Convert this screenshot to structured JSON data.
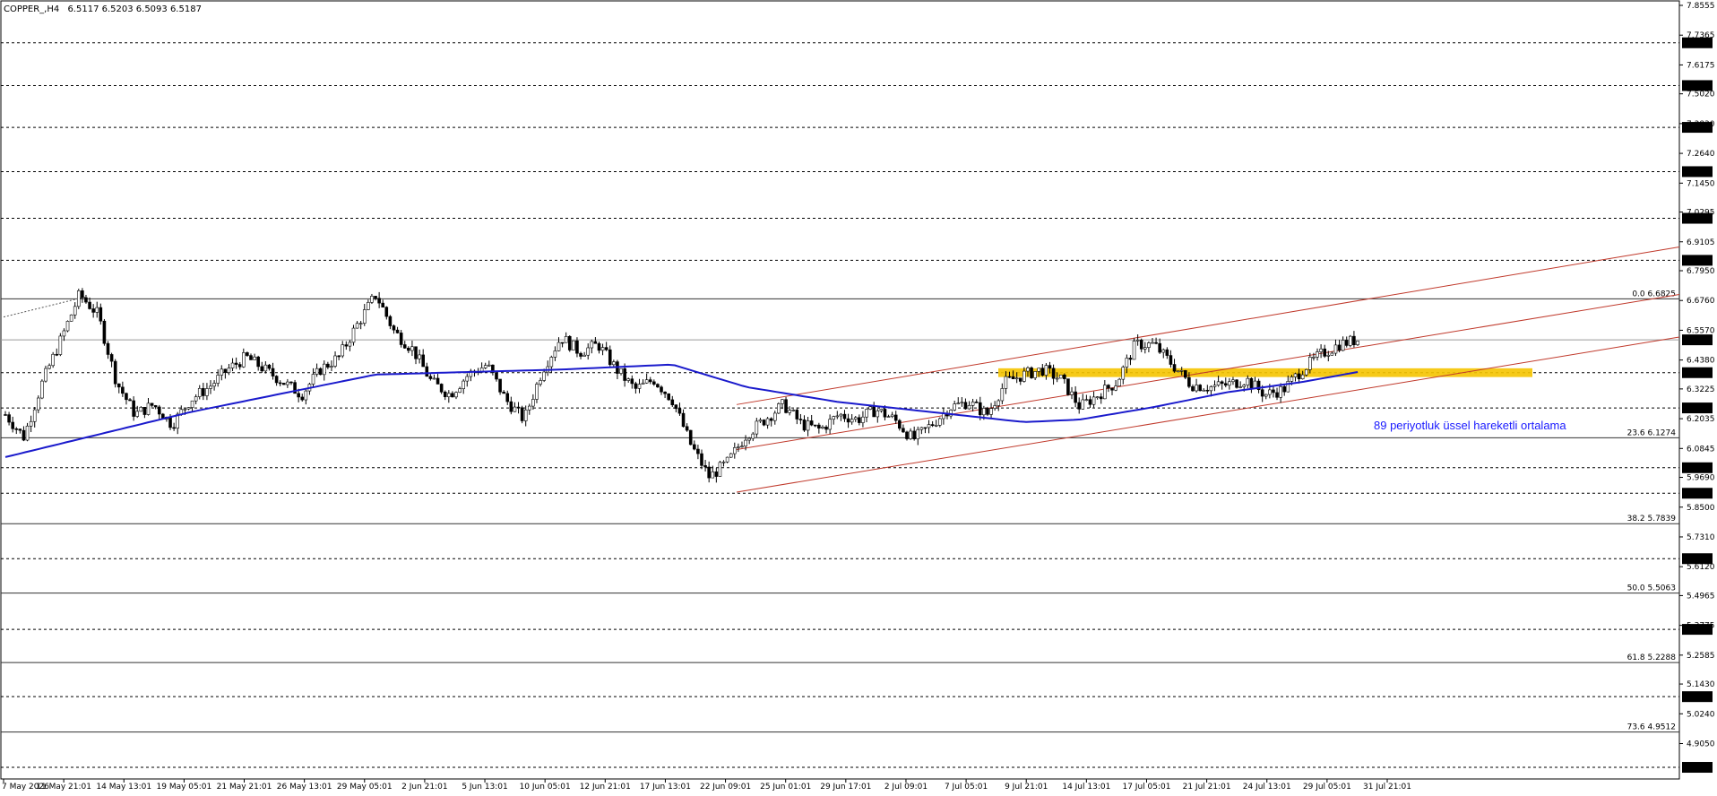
{
  "header": {
    "symbol": "COPPER_,H4",
    "ohlc": "6.5117 6.5203 6.5093 6.5187"
  },
  "annotation": "89 periyotluk üssel hareketli ortalama",
  "chart_data": {
    "type": "candlestick",
    "yaxis": {
      "range": [
        4.785,
        7.8555
      ],
      "ticks": [
        "7.8555",
        "7.7365",
        "7.6175",
        "7.5020",
        "7.3830",
        "7.2640",
        "7.1450",
        "7.0295",
        "6.9105",
        "6.7950",
        "6.6760",
        "6.5570",
        "6.4380",
        "6.3225",
        "6.2035",
        "6.0845",
        "5.9690",
        "5.8500",
        "5.7310",
        "5.6120",
        "5.4965",
        "5.3775",
        "5.2585",
        "5.1430",
        "5.0240",
        "4.9050"
      ]
    },
    "xaxis": {
      "ticks": [
        "7 May 2026",
        "11 May 21:01",
        "14 May 13:01",
        "19 May 05:01",
        "21 May 21:01",
        "26 May 13:01",
        "29 May 05:01",
        "2 Jun 21:01",
        "5 Jun 13:01",
        "10 Jun 05:01",
        "12 Jun 21:01",
        "17 Jun 13:01",
        "22 Jun 09:01",
        "25 Jun 01:01",
        "29 Jun 17:01",
        "2 Jul 09:01",
        "7 Jul 05:01",
        "9 Jul 21:01",
        "14 Jul 13:01",
        "17 Jul 05:01",
        "21 Jul 21:01",
        "24 Jul 13:01",
        "29 Jul 05:01",
        "31 Jul 21:01"
      ]
    },
    "horizontal_levels": [
      "7.7060",
      "7.5350",
      "7.3680",
      "7.1910",
      "7.0045",
      "6.8365",
      "6.3875",
      "6.2465",
      "6.0075",
      "5.9055",
      "5.6440",
      "5.3615",
      "5.0925",
      "4.8100"
    ],
    "current_price": "6.5187",
    "fibonacci": [
      {
        "label": "0.0 6.6825",
        "value": 6.6825
      },
      {
        "label": "23.6 6.1274",
        "value": 6.1274
      },
      {
        "label": "38.2 5.7839",
        "value": 5.7839
      },
      {
        "label": "50.0 5.5063",
        "value": 5.5063
      },
      {
        "label": "61.8 5.2288",
        "value": 5.2288
      },
      {
        "label": "73.6 4.9512",
        "value": 4.9512
      }
    ],
    "price_path": [
      [
        0,
        6.22
      ],
      [
        1,
        6.13
      ],
      [
        2,
        6.35
      ],
      [
        3,
        6.52
      ],
      [
        4,
        6.7
      ],
      [
        5,
        6.62
      ],
      [
        6,
        6.35
      ],
      [
        7,
        6.22
      ],
      [
        8,
        6.26
      ],
      [
        9,
        6.18
      ],
      [
        10,
        6.28
      ],
      [
        11,
        6.33
      ],
      [
        12,
        6.4
      ],
      [
        13,
        6.45
      ],
      [
        14,
        6.4
      ],
      [
        15,
        6.35
      ],
      [
        16,
        6.3
      ],
      [
        17,
        6.4
      ],
      [
        18,
        6.45
      ],
      [
        19,
        6.58
      ],
      [
        20,
        6.7
      ],
      [
        21,
        6.55
      ],
      [
        22,
        6.48
      ],
      [
        23,
        6.35
      ],
      [
        24,
        6.3
      ],
      [
        25,
        6.38
      ],
      [
        26,
        6.42
      ],
      [
        27,
        6.28
      ],
      [
        28,
        6.2
      ],
      [
        29,
        6.4
      ],
      [
        30,
        6.53
      ],
      [
        31,
        6.47
      ],
      [
        32,
        6.5
      ],
      [
        33,
        6.4
      ],
      [
        34,
        6.32
      ],
      [
        35,
        6.36
      ],
      [
        36,
        6.28
      ],
      [
        37,
        6.1
      ],
      [
        38,
        5.97
      ],
      [
        39,
        6.03
      ],
      [
        40,
        6.14
      ],
      [
        41,
        6.2
      ],
      [
        42,
        6.26
      ],
      [
        43,
        6.18
      ],
      [
        44,
        6.16
      ],
      [
        45,
        6.22
      ],
      [
        46,
        6.2
      ],
      [
        47,
        6.24
      ],
      [
        48,
        6.2
      ],
      [
        49,
        6.12
      ],
      [
        50,
        6.18
      ],
      [
        51,
        6.25
      ],
      [
        52,
        6.27
      ],
      [
        53,
        6.22
      ],
      [
        54,
        6.35
      ],
      [
        55,
        6.38
      ],
      [
        56,
        6.4
      ],
      [
        57,
        6.36
      ],
      [
        58,
        6.25
      ],
      [
        59,
        6.3
      ],
      [
        60,
        6.35
      ],
      [
        61,
        6.5
      ],
      [
        62,
        6.5
      ],
      [
        63,
        6.42
      ],
      [
        64,
        6.34
      ],
      [
        65,
        6.33
      ],
      [
        66,
        6.34
      ],
      [
        67,
        6.36
      ],
      [
        68,
        6.3
      ],
      [
        69,
        6.32
      ],
      [
        70,
        6.4
      ],
      [
        71,
        6.46
      ],
      [
        72,
        6.5
      ],
      [
        73,
        6.52
      ]
    ],
    "ema89_path": [
      [
        0,
        6.05
      ],
      [
        10,
        6.23
      ],
      [
        20,
        6.38
      ],
      [
        30,
        6.4
      ],
      [
        36,
        6.42
      ],
      [
        40,
        6.33
      ],
      [
        45,
        6.27
      ],
      [
        50,
        6.23
      ],
      [
        55,
        6.19
      ],
      [
        58,
        6.2
      ],
      [
        62,
        6.25
      ],
      [
        66,
        6.31
      ],
      [
        70,
        6.35
      ],
      [
        73,
        6.39
      ]
    ],
    "channel": {
      "upper": [
        [
          6.26,
          0
        ],
        [
          6.89,
          1
        ]
      ],
      "middle": [
        [
          6.08,
          0
        ],
        [
          6.7,
          1
        ]
      ],
      "lower": [
        [
          5.91,
          0
        ],
        [
          6.53,
          1
        ]
      ]
    },
    "zone": [
      6.37,
      6.405
    ]
  }
}
